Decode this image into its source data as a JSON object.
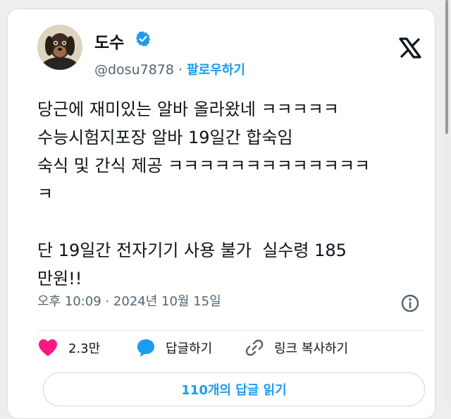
{
  "user": {
    "name": "도수",
    "handle": "@dosu7878",
    "separator": "·",
    "follow_label": "팔로우하기",
    "verified": true
  },
  "tweet": {
    "text": "당근에 재미있는 알바 올라왔네 ㅋㅋㅋㅋㅋ\n수능시험지포장 알바 19일간 합숙임\n숙식 및 간식 제공 ㅋㅋㅋㅋㅋㅋㅋㅋㅋㅋㅋㅋㅋ\nㅋ\n\n단 19일간 전자기기 사용 불가  실수령 185\n만원!!",
    "time": "오후 10:09",
    "date": "2024년 10월 15일"
  },
  "actions": {
    "likes": "2.3만",
    "reply_label": "답글하기",
    "copy_link_label": "링크 복사하기",
    "read_replies_label": "110개의 답글 읽기"
  },
  "colors": {
    "accent": "#1d9bf0",
    "like": "#f91880",
    "text": "#0f1419",
    "muted": "#536471"
  }
}
